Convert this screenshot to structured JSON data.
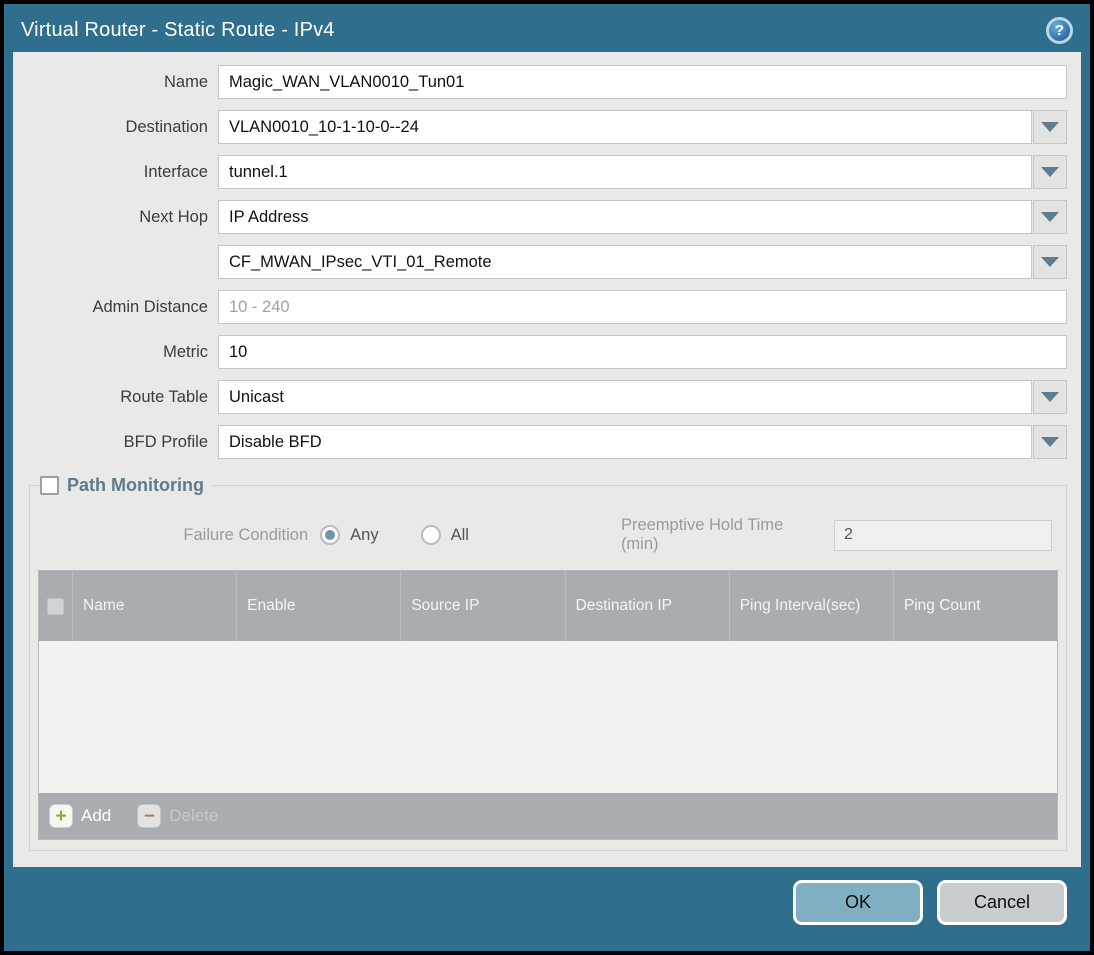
{
  "titlebar": {
    "title": "Virtual Router - Static Route - IPv4",
    "help_glyph": "?"
  },
  "form": {
    "name": {
      "label": "Name",
      "value": "Magic_WAN_VLAN0010_Tun01"
    },
    "destination": {
      "label": "Destination",
      "value": "VLAN0010_10-1-10-0--24"
    },
    "interface": {
      "label": "Interface",
      "value": "tunnel.1"
    },
    "next_hop": {
      "label": "Next Hop",
      "value": "IP Address"
    },
    "next_hop_address": {
      "value": "CF_MWAN_IPsec_VTI_01_Remote"
    },
    "admin_distance": {
      "label": "Admin Distance",
      "placeholder": "10 - 240",
      "value": ""
    },
    "metric": {
      "label": "Metric",
      "value": "10"
    },
    "route_table": {
      "label": "Route Table",
      "value": "Unicast"
    },
    "bfd_profile": {
      "label": "BFD Profile",
      "value": "Disable BFD"
    }
  },
  "path_monitoring": {
    "legend": "Path Monitoring",
    "checkbox_checked": false,
    "failure_condition": {
      "label": "Failure Condition",
      "options": [
        "Any",
        "All"
      ],
      "selected": "Any"
    },
    "preemptive_hold": {
      "label": "Preemptive Hold Time (min)",
      "value": "2"
    },
    "table": {
      "columns": [
        "Name",
        "Enable",
        "Source IP",
        "Destination IP",
        "Ping Interval(sec)",
        "Ping Count"
      ],
      "rows": []
    },
    "toolbar": {
      "add_label": "Add",
      "delete_label": "Delete"
    }
  },
  "footer": {
    "ok_label": "OK",
    "cancel_label": "Cancel"
  },
  "colors": {
    "frame_teal": "#306e8e",
    "body_gray": "#e9e9e7",
    "table_header_gray": "#a9adb0",
    "legend_teal": "#5f7c8c",
    "ok_button": "#80aec3",
    "cancel_button": "#c9cdd0",
    "radio_selected": "#6e96ac",
    "add_plus_green": "#8aa63c",
    "delete_minus_red": "#a96a62"
  }
}
